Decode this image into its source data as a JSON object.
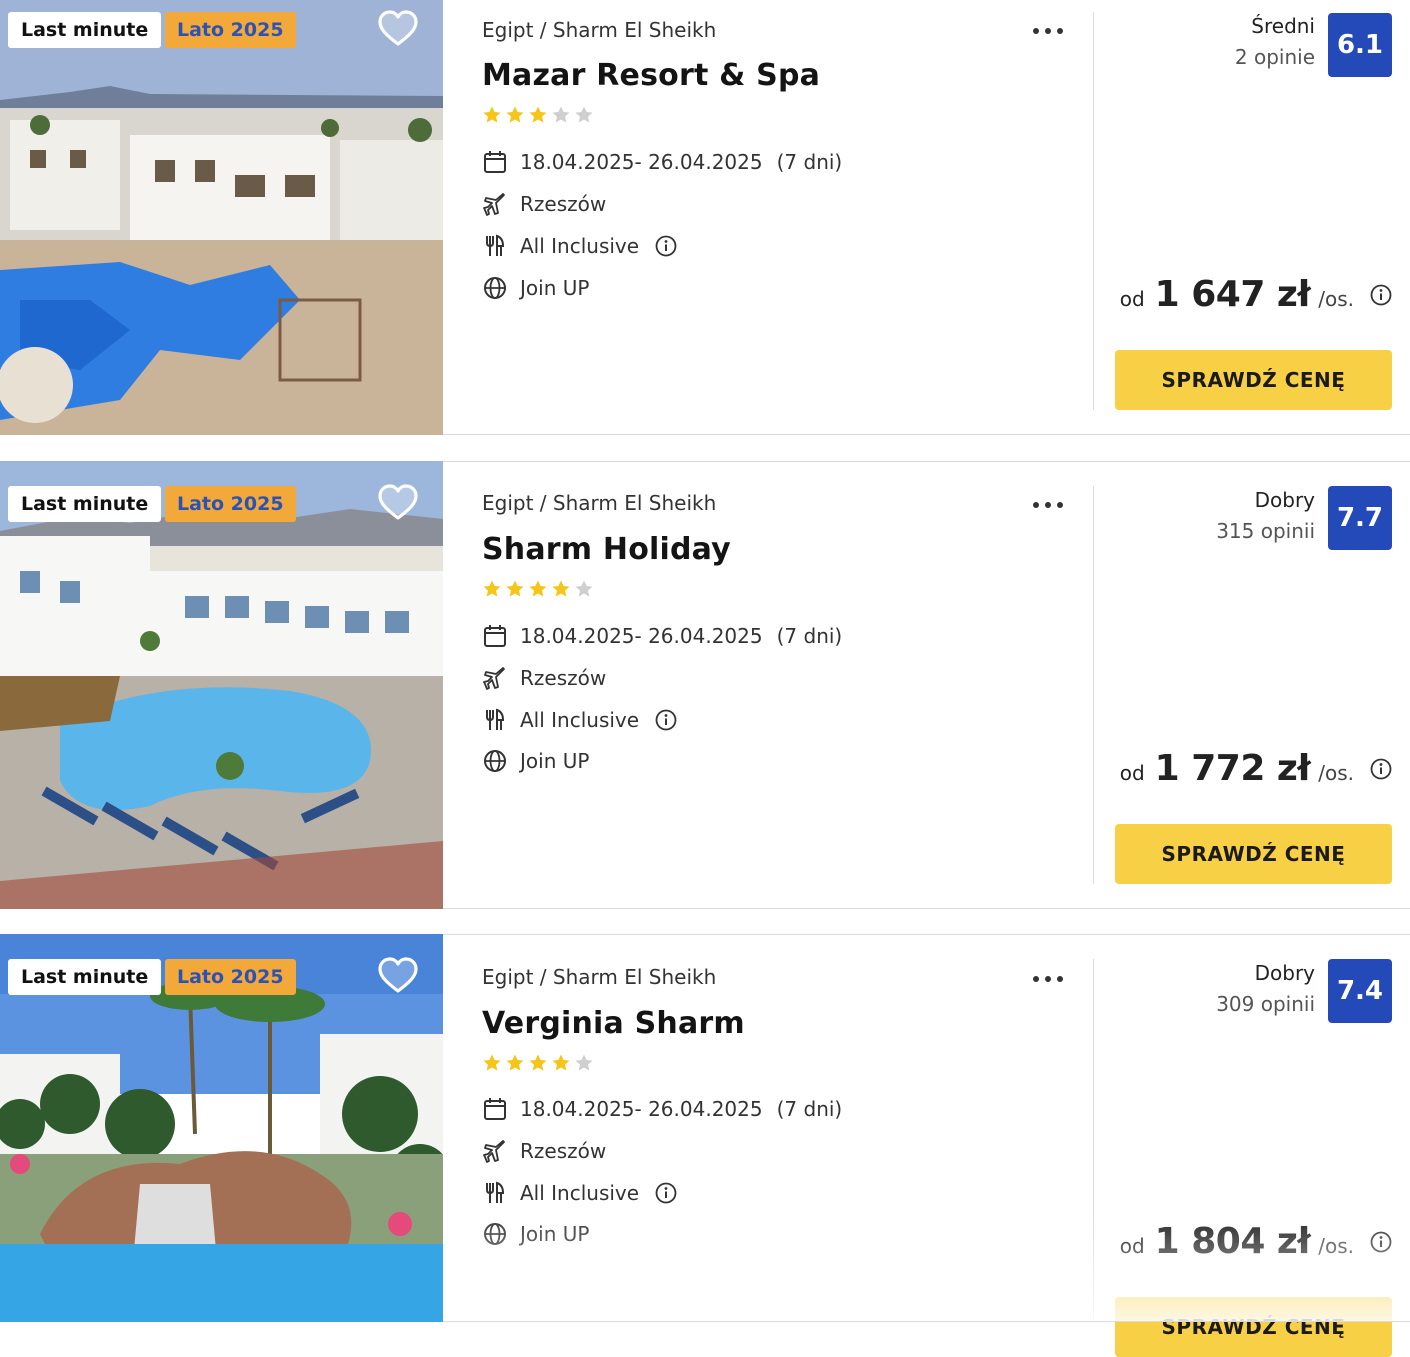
{
  "labels": {
    "od": "od",
    "per_person": "/os.",
    "cta": "SPRAWDŹ CENĘ"
  },
  "colors": {
    "score_bg": "#2449b9",
    "cta_bg": "#f7d046",
    "lato_badge_bg": "#f2a93a",
    "lato_badge_text": "#2c52b8",
    "star_filled": "#f5c518",
    "star_empty": "#cfcfcf"
  },
  "offers": [
    {
      "badges": [
        "Last minute",
        "Lato 2025"
      ],
      "location": "Egipt / Sharm El Sheikh",
      "name": "Mazar Resort & Spa",
      "stars": 3,
      "dates": "18.04.2025- 26.04.2025",
      "duration": "(7 dni)",
      "departure": "Rzeszów",
      "board": "All Inclusive",
      "tour_operator": "Join UP",
      "rating_label": "Średni",
      "reviews": "2 opinie",
      "score": "6.1",
      "price": "1 647 zł",
      "icons": {
        "favorite": "heart-icon",
        "more": "more-dots-icon",
        "dates": "calendar-icon",
        "departure": "plane-icon",
        "board": "cutlery-icon",
        "operator": "globe-icon",
        "info": "info-icon"
      }
    },
    {
      "badges": [
        "Last minute",
        "Lato 2025"
      ],
      "location": "Egipt / Sharm El Sheikh",
      "name": "Sharm Holiday",
      "stars": 4,
      "dates": "18.04.2025- 26.04.2025",
      "duration": "(7 dni)",
      "departure": "Rzeszów",
      "board": "All Inclusive",
      "tour_operator": "Join UP",
      "rating_label": "Dobry",
      "reviews": "315 opinii",
      "score": "7.7",
      "price": "1 772 zł",
      "icons": {
        "favorite": "heart-icon",
        "more": "more-dots-icon",
        "dates": "calendar-icon",
        "departure": "plane-icon",
        "board": "cutlery-icon",
        "operator": "globe-icon",
        "info": "info-icon"
      }
    },
    {
      "badges": [
        "Last minute",
        "Lato 2025"
      ],
      "location": "Egipt / Sharm El Sheikh",
      "name": "Verginia Sharm",
      "stars": 4,
      "dates": "18.04.2025- 26.04.2025",
      "duration": "(7 dni)",
      "departure": "Rzeszów",
      "board": "All Inclusive",
      "tour_operator": "Join UP",
      "rating_label": "Dobry",
      "reviews": "309 opinii",
      "score": "7.4",
      "price": "1 804 zł",
      "icons": {
        "favorite": "heart-icon",
        "more": "more-dots-icon",
        "dates": "calendar-icon",
        "departure": "plane-icon",
        "board": "cutlery-icon",
        "operator": "globe-icon",
        "info": "info-icon"
      }
    }
  ]
}
